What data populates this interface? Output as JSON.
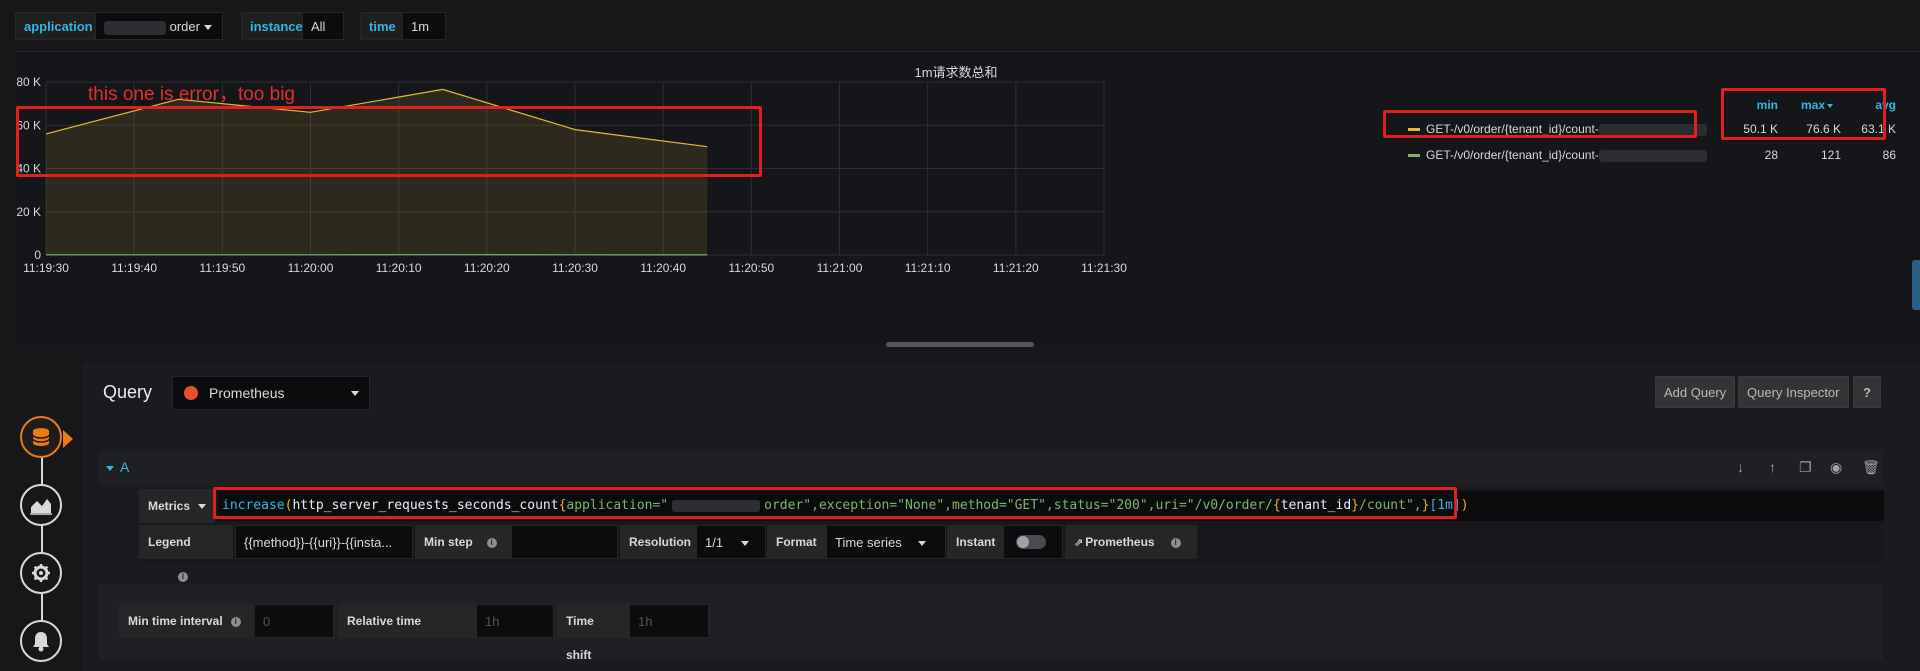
{
  "variables": {
    "application": {
      "label": "application",
      "value": "order"
    },
    "instance": {
      "label": "instance",
      "value": "All"
    },
    "time": {
      "label": "time",
      "value": "1m"
    }
  },
  "panel": {
    "title": "1m请求数总和",
    "annotation": "this one is error，too big",
    "colors": {
      "series1": "#eab839",
      "series2": "#7eb26d",
      "annotation": "#e02020",
      "accent": "#33b5e5"
    }
  },
  "chart_data": {
    "type": "area",
    "title": "1m请求数总和",
    "x_ticks": [
      "11:19:30",
      "11:19:40",
      "11:19:50",
      "11:20:00",
      "11:20:10",
      "11:20:20",
      "11:20:30",
      "11:20:40",
      "11:20:50",
      "11:21:00",
      "11:21:10",
      "11:21:20",
      "11:21:30"
    ],
    "y_ticks": [
      "0",
      "20 K",
      "40 K",
      "60 K",
      "80 K"
    ],
    "ylim": [
      0,
      80000
    ],
    "xlim": [
      "11:19:30",
      "11:21:30"
    ],
    "grid": true,
    "legend": "right",
    "series": [
      {
        "name": "GET-/v0/order/{tenant_id}/count-",
        "color": "#eab839",
        "x": [
          "11:19:30",
          "11:19:45",
          "11:20:00",
          "11:20:15",
          "11:20:30",
          "11:20:45"
        ],
        "values": [
          56000,
          72000,
          66000,
          76600,
          58000,
          50100
        ]
      },
      {
        "name": "GET-/v0/order/{tenant_id}/count-",
        "color": "#7eb26d",
        "x": [
          "11:19:30",
          "11:19:45",
          "11:20:00",
          "11:20:15",
          "11:20:30",
          "11:20:45"
        ],
        "values": [
          86,
          90,
          80,
          121,
          70,
          28
        ]
      }
    ]
  },
  "legend": {
    "headers": {
      "min": "min",
      "max": "max",
      "avg": "avg"
    },
    "rows": [
      {
        "name": "GET-/v0/order/{tenant_id}/count-",
        "min": "50.1 K",
        "max": "76.6 K",
        "avg": "63.1 K"
      },
      {
        "name": "GET-/v0/order/{tenant_id}/count-",
        "min": "28",
        "max": "121",
        "avg": "86"
      }
    ]
  },
  "editor": {
    "title": "Query",
    "datasource": "Prometheus",
    "add_query": "Add Query",
    "query_inspector": "Query Inspector",
    "help": "?",
    "query_ref": "A",
    "metrics_label": "Metrics",
    "expr": {
      "fn": "increase",
      "metric": "http_server_requests_seconds_count",
      "application_key": "application=\"",
      "application_tail": "order\"",
      "rest1": ",exception=\"None\",method=\"GET\",status=\"200\",uri=\"/v0/order/",
      "tenant": "tenant_id",
      "rest2": "/count\",",
      "range": "[1m]"
    },
    "legend_label": "Legend",
    "legend_value": "{{method}}-{{uri}}-{{insta...",
    "min_step_label": "Min step",
    "min_step_value": "",
    "resolution_label": "Resolution",
    "resolution_value": "1/1",
    "format_label": "Format",
    "format_value": "Time series",
    "instant_label": "Instant",
    "prometheus_link": "Prometheus",
    "min_time_interval_label": "Min time interval",
    "min_time_interval_placeholder": "0",
    "relative_time_label": "Relative time",
    "relative_time_placeholder": "1h",
    "time_shift_label": "Time shift",
    "time_shift_placeholder": "1h"
  }
}
